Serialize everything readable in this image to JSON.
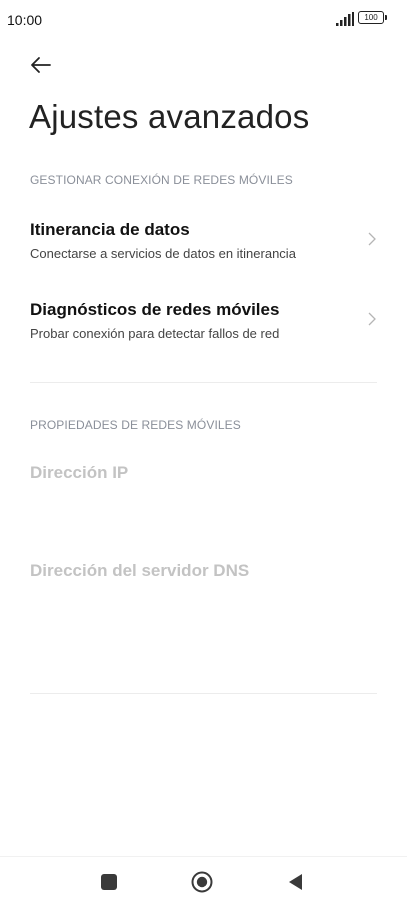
{
  "status_bar": {
    "time": "10:00",
    "battery_level": "100",
    "signal_icon": "signal-bars-icon"
  },
  "header": {
    "back_icon": "arrow-left-icon",
    "title": "Ajustes avanzados"
  },
  "sections": [
    {
      "header": "GESTIONAR CONEXIÓN DE REDES MÓVILES",
      "items": [
        {
          "title": "Itinerancia de datos",
          "subtitle": "Conectarse a servicios de datos en itinerancia"
        },
        {
          "title": "Diagnósticos de redes móviles",
          "subtitle": "Probar conexión para detectar fallos de red"
        }
      ]
    },
    {
      "header": "PROPIEDADES DE REDES MÓVILES",
      "items": [
        {
          "title": "Dirección IP"
        },
        {
          "title": "Dirección del servidor DNS"
        }
      ]
    }
  ],
  "nav_bar": {
    "recents_icon": "square-icon",
    "home_icon": "circle-icon",
    "back_icon": "triangle-back-icon"
  },
  "colors": {
    "section_header": "#8a8f99",
    "disabled_text": "#c3c3c3",
    "divider": "#ececec"
  }
}
